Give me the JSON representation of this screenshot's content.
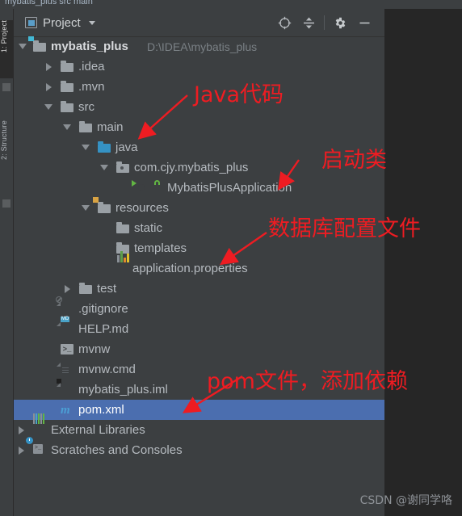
{
  "window": {
    "breadcrumb": "mybatis_plus  src  main"
  },
  "toolstrip": {
    "tabs": [
      {
        "label": "1: Project",
        "active": true
      },
      {
        "label": "2: Structure",
        "active": false
      }
    ]
  },
  "panel": {
    "title": "Project",
    "title_icon": "project-icon",
    "dropdown_icon": "chevron-down-icon",
    "tools": [
      {
        "name": "locate-icon",
        "label": "Select Opened File"
      },
      {
        "name": "collapse-all-icon",
        "label": "Collapse All"
      },
      {
        "name": "gear-icon",
        "label": "Settings"
      },
      {
        "name": "minimize-icon",
        "label": "Hide"
      }
    ]
  },
  "tree": {
    "nodes": [
      {
        "label": "mybatis_plus",
        "sublabel": "D:\\IDEA\\mybatis_plus",
        "icon": "module-folder-icon",
        "depth": 0,
        "arrow": "open",
        "bold": true,
        "selected": false
      },
      {
        "label": ".idea",
        "sublabel": "",
        "icon": "folder-icon",
        "depth": 1,
        "arrow": "closed",
        "bold": false,
        "selected": false
      },
      {
        "label": ".mvn",
        "sublabel": "",
        "icon": "folder-icon",
        "depth": 1,
        "arrow": "closed",
        "bold": false,
        "selected": false
      },
      {
        "label": "src",
        "sublabel": "",
        "icon": "folder-icon",
        "depth": 1,
        "arrow": "open",
        "bold": false,
        "selected": false
      },
      {
        "label": "main",
        "sublabel": "",
        "icon": "folder-icon",
        "depth": 2,
        "arrow": "open",
        "bold": false,
        "selected": false
      },
      {
        "label": "java",
        "sublabel": "",
        "icon": "source-folder-icon",
        "depth": 3,
        "arrow": "open",
        "bold": false,
        "selected": false
      },
      {
        "label": "com.cjy.mybatis_plus",
        "sublabel": "",
        "icon": "package-icon",
        "depth": 4,
        "arrow": "open",
        "bold": false,
        "selected": false
      },
      {
        "label": "MybatisPlusApplication",
        "sublabel": "",
        "icon": "java-class-icon",
        "depth": 5,
        "arrow": "none",
        "bold": false,
        "selected": false
      },
      {
        "label": "resources",
        "sublabel": "",
        "icon": "resources-folder-icon",
        "depth": 3,
        "arrow": "open",
        "bold": false,
        "selected": false
      },
      {
        "label": "static",
        "sublabel": "",
        "icon": "folder-icon",
        "depth": 4,
        "arrow": "none",
        "bold": false,
        "selected": false
      },
      {
        "label": "templates",
        "sublabel": "",
        "icon": "folder-icon",
        "depth": 4,
        "arrow": "none",
        "bold": false,
        "selected": false
      },
      {
        "label": "application.properties",
        "sublabel": "",
        "icon": "properties-file-icon",
        "depth": 4,
        "arrow": "none",
        "bold": false,
        "selected": false
      },
      {
        "label": "test",
        "sublabel": "",
        "icon": "folder-icon",
        "depth": 2,
        "arrow": "closed",
        "bold": false,
        "selected": false
      },
      {
        "label": ".gitignore",
        "sublabel": "",
        "icon": "gitignore-file-icon",
        "depth": 2,
        "arrow": "none",
        "bold": false,
        "selected": false
      },
      {
        "label": "HELP.md",
        "sublabel": "",
        "icon": "markdown-file-icon",
        "depth": 2,
        "arrow": "none",
        "bold": false,
        "selected": false
      },
      {
        "label": "mvnw",
        "sublabel": "",
        "icon": "shell-file-icon",
        "depth": 2,
        "arrow": "none",
        "bold": false,
        "selected": false
      },
      {
        "label": "mvnw.cmd",
        "sublabel": "",
        "icon": "text-file-icon",
        "depth": 2,
        "arrow": "none",
        "bold": false,
        "selected": false
      },
      {
        "label": "mybatis_plus.iml",
        "sublabel": "",
        "icon": "iml-file-icon",
        "depth": 2,
        "arrow": "none",
        "bold": false,
        "selected": false
      },
      {
        "label": "pom.xml",
        "sublabel": "",
        "icon": "maven-xml-icon",
        "depth": 2,
        "arrow": "none",
        "bold": false,
        "selected": true
      },
      {
        "label": "External Libraries",
        "sublabel": "",
        "icon": "libraries-icon",
        "depth": 0,
        "arrow": "closed",
        "bold": false,
        "selected": false
      },
      {
        "label": "Scratches and Consoles",
        "sublabel": "",
        "icon": "scratches-icon",
        "depth": 0,
        "arrow": "closed",
        "bold": false,
        "selected": false
      }
    ]
  },
  "annotations": [
    {
      "text": "Java代码",
      "color": "#ee1c22"
    },
    {
      "text": "启动类",
      "color": "#ee1c22"
    },
    {
      "text": "数据库配置文件",
      "color": "#ee1c22"
    },
    {
      "text": "pom文件，添加依赖",
      "color": "#ee1c22"
    }
  ],
  "watermark": "CSDN @谢同学咯",
  "colors": {
    "panel_bg": "#3c3f41",
    "editor_bg": "#262626",
    "selection": "#4b6eaf",
    "text": "#b6bbc0",
    "annotation": "#ee1c22",
    "folder_blue": "#3592c4"
  }
}
